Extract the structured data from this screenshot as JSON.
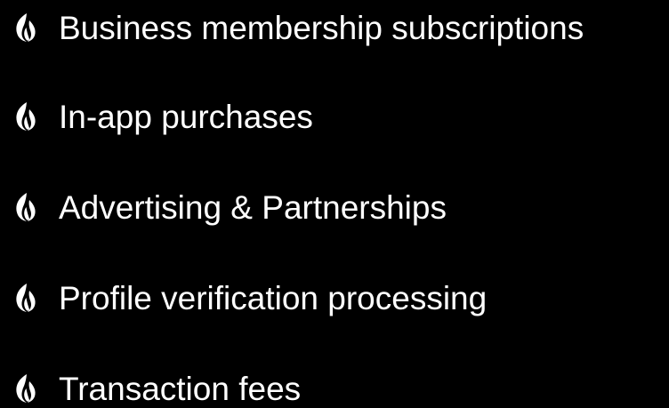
{
  "colors": {
    "background": "#000000",
    "text": "#ffffff",
    "icon": "#ffffff"
  },
  "bullet_icon": "flame-icon",
  "items": [
    {
      "label": "Business membership subscriptions"
    },
    {
      "label": "In-app purchases"
    },
    {
      "label": "Advertising & Partnerships"
    },
    {
      "label": "Profile verification processing"
    },
    {
      "label": "Transaction fees"
    }
  ]
}
